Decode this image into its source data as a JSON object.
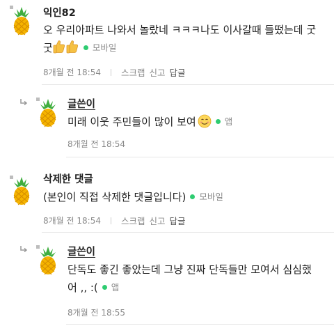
{
  "comments": [
    {
      "author": "익인82",
      "text": "오 우리아파트 나와서 놀랐네 ㅋㅋㅋ나도 이사갈때 들떴는데 굿",
      "text2": "굿",
      "source": "모바일",
      "time": "8개월 전 18:54",
      "scrap": "스크랩",
      "report": "신고",
      "reply": "답글"
    },
    {
      "author": "글쓴이",
      "text": "미래 이웃 주민들이 많이 보여",
      "source": "앱",
      "time": "8개월 전 18:54"
    },
    {
      "author": "삭제한 댓글",
      "text": "(본인이 직접 삭제한 댓글입니다)",
      "source": "모바일",
      "time": "8개월 전 18:54",
      "scrap": "스크랩",
      "report": "신고",
      "reply": "답글"
    },
    {
      "author": "글쓴이",
      "text": "단독도 좋긴 좋았는데 그냥 진짜 단독들만 모여서 심심했",
      "text2": "어 ,, :(",
      "source": "앱",
      "time": "8개월 전 18:55"
    }
  ],
  "colors": {
    "source_dot": "#2ecc71",
    "meta_text": "#8a8a8a",
    "divider": "#e6e6e6",
    "pineapple_body": "#f5b400",
    "pineapple_leaf": "#3fae3f"
  },
  "icons": {
    "avatar": "pineapple-icon",
    "reply_indicator": "reply-arrow-icon",
    "thumbs_up": "thumbs-up-emoji",
    "smile": "smiling-face-emoji"
  }
}
